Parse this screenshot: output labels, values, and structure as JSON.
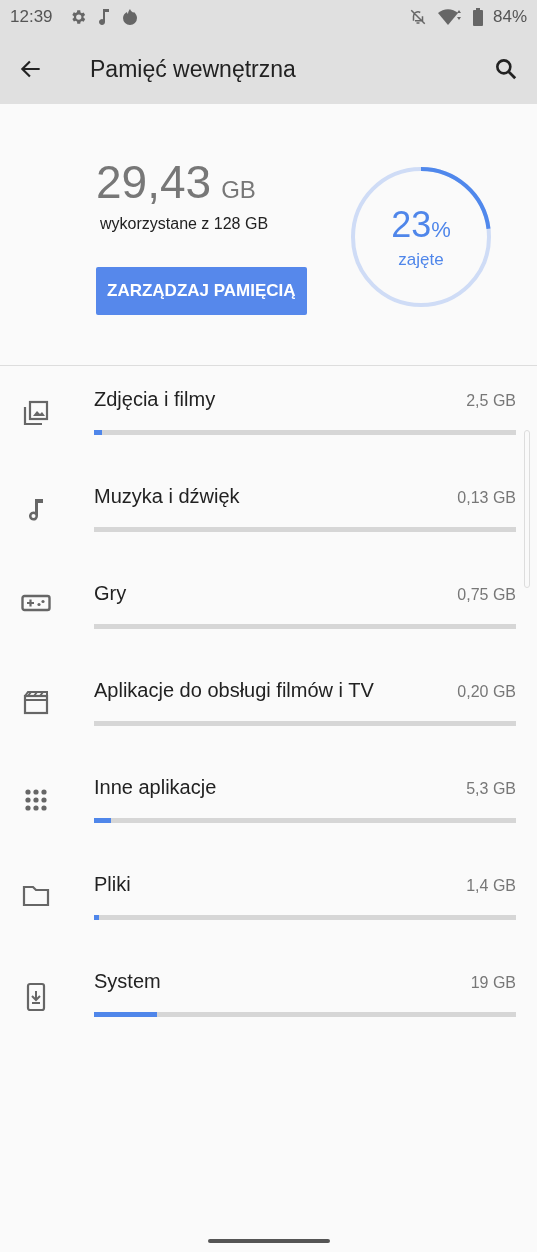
{
  "status_bar": {
    "time": "12:39",
    "battery": "84%"
  },
  "toolbar": {
    "title": "Pamięć wewnętrzna"
  },
  "summary": {
    "used": "29,43",
    "unit": "GB",
    "caption": "wykorzystane z 128 GB",
    "button": "ZARZĄDZAJ PAMIĘCIĄ",
    "ring": {
      "level": 0.23,
      "percent": "23",
      "percent_sign": "%",
      "label": "zajęte"
    }
  },
  "categories": [
    {
      "kind": "photos",
      "name": "Zdjęcia i filmy",
      "size": "2,5 GB",
      "level": 0.02
    },
    {
      "kind": "music",
      "name": "Muzyka i dźwięk",
      "size": "0,13 GB"
    },
    {
      "kind": "games",
      "name": "Gry",
      "size": "0,75 GB"
    },
    {
      "kind": "video",
      "name": "Aplikacje do obsługi filmów i TV",
      "size": "0,20 GB"
    },
    {
      "kind": "apps",
      "name": "Inne aplikacje",
      "size": "5,3 GB",
      "level": 0.04
    },
    {
      "kind": "files",
      "name": "Pliki",
      "size": "1,4 GB",
      "level": 0.011
    },
    {
      "kind": "system",
      "name": "System",
      "size": "19 GB",
      "level": 0.15
    }
  ]
}
